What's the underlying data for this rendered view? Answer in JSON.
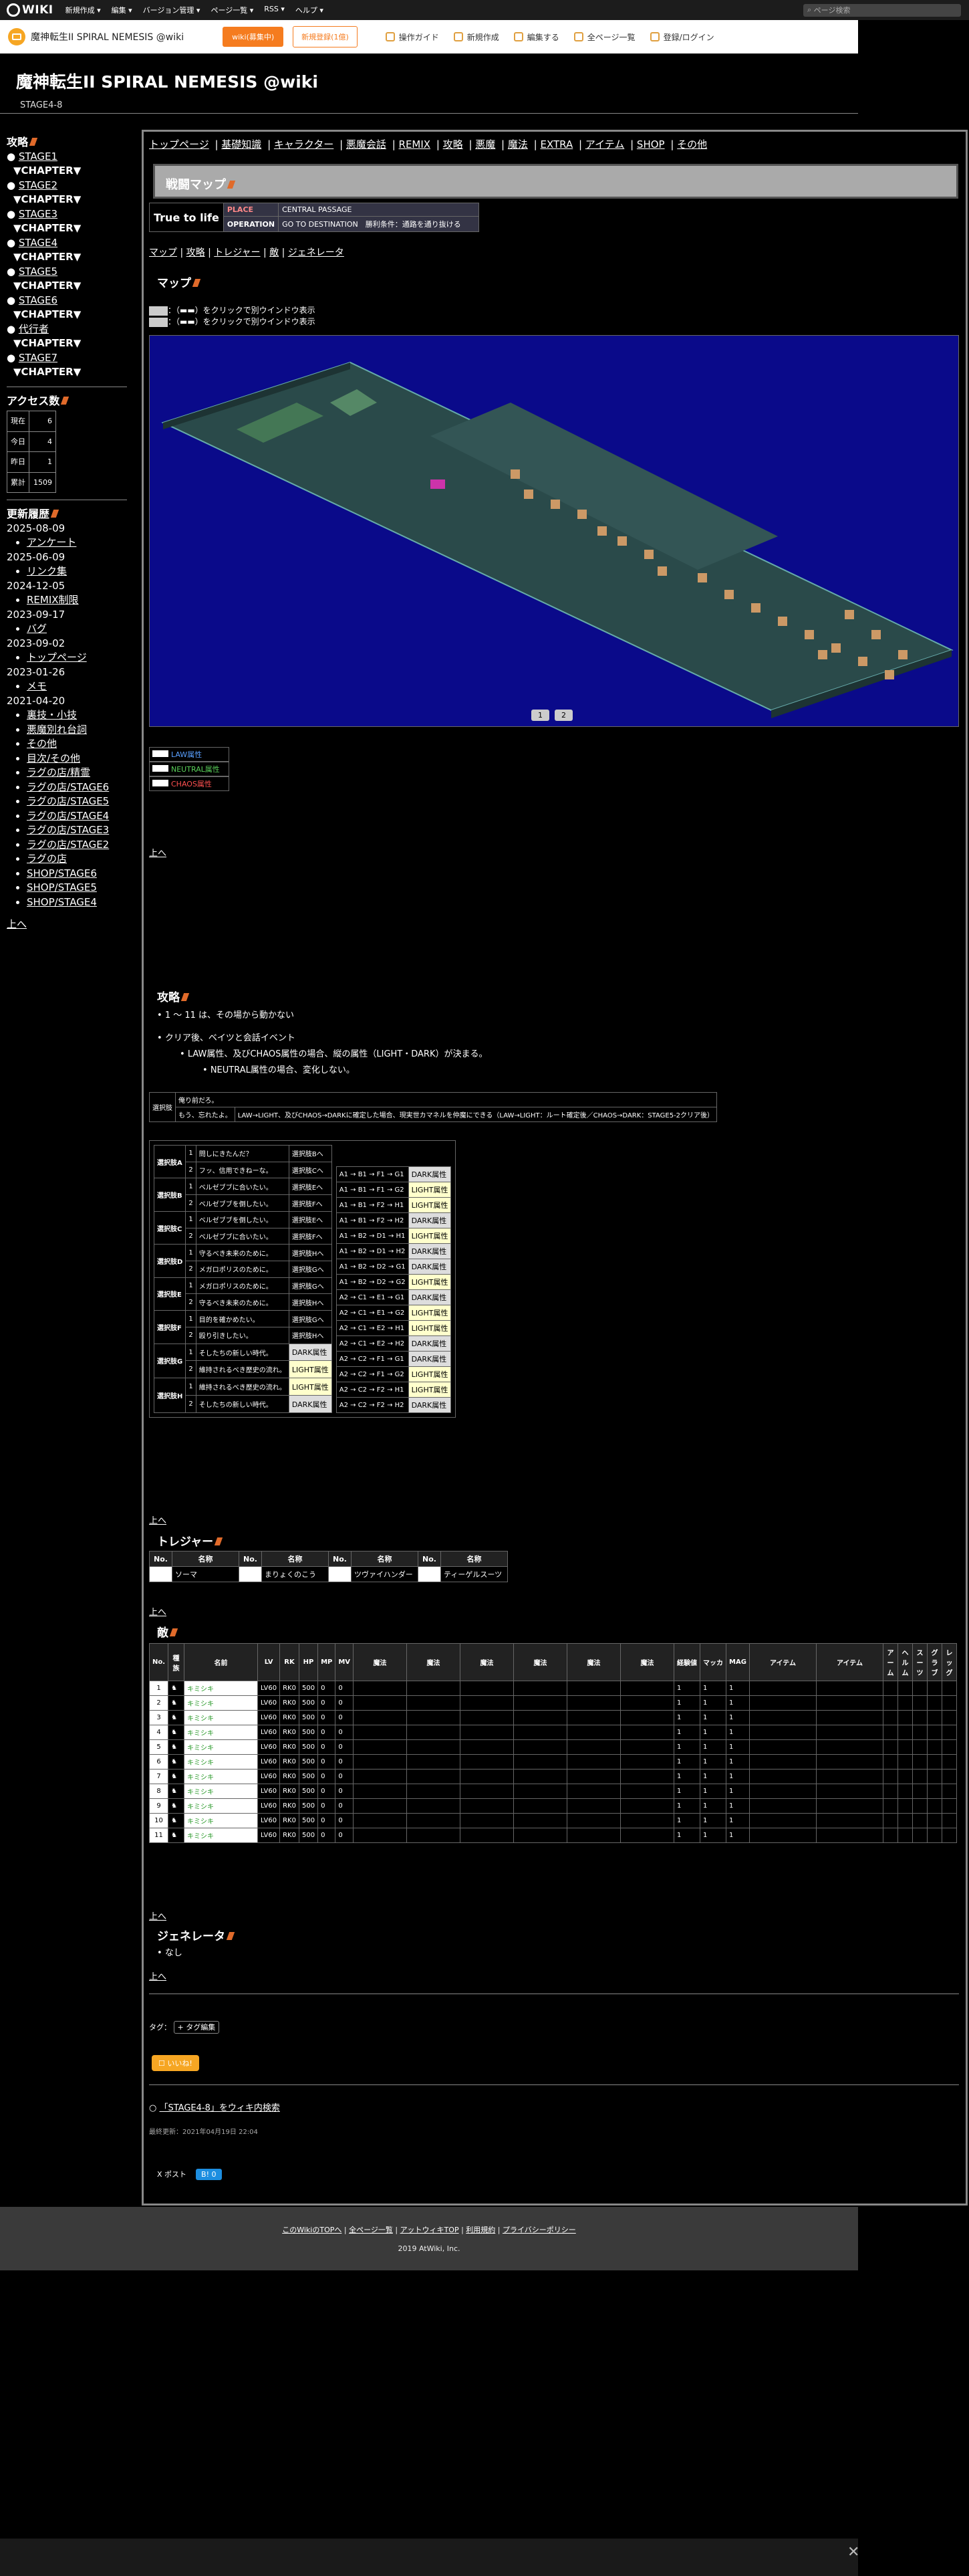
{
  "topbar": {
    "logo": "WIKI",
    "menu": [
      "新規作成 ▾",
      "編集 ▾",
      "バージョン管理 ▾",
      "ページ一覧 ▾",
      "RSS ▾",
      "ヘルプ ▾"
    ],
    "search_placeholder": "ページ検索"
  },
  "wikibar": {
    "title": "魔神転生II SPIRAL NEMESIS @wiki",
    "wiki_btn": "wiki(募集中)",
    "register_btn": "新規登録(1億)",
    "actions": [
      "操作ガイド",
      "新規作成",
      "編集する",
      "全ページ一覧",
      "登録/ログイン"
    ]
  },
  "header": {
    "title": "魔神転生II SPIRAL NEMESIS @wiki",
    "subtitle": "STAGE4-8"
  },
  "sidebar": {
    "strategy_title": "攻略",
    "stages": [
      {
        "stage": "STAGE1",
        "chapter": "▼CHAPTER▼"
      },
      {
        "stage": "STAGE2",
        "chapter": "▼CHAPTER▼"
      },
      {
        "stage": "STAGE3",
        "chapter": "▼CHAPTER▼"
      },
      {
        "stage": "STAGE4",
        "chapter": "▼CHAPTER▼"
      },
      {
        "stage": "STAGE5",
        "chapter": "▼CHAPTER▼"
      },
      {
        "stage": "STAGE6",
        "chapter": "▼CHAPTER▼"
      },
      {
        "stage": "代行者",
        "chapter": "▼CHAPTER▼"
      },
      {
        "stage": "STAGE7",
        "chapter": "▼CHAPTER▼"
      }
    ],
    "access_title": "アクセス数",
    "access": [
      [
        "現在",
        "6"
      ],
      [
        "今日",
        "4"
      ],
      [
        "昨日",
        "1"
      ],
      [
        "累計",
        "1509"
      ]
    ],
    "history_title": "更新履歴",
    "history": [
      {
        "date": "2025-08-09",
        "items": [
          "アンケート"
        ]
      },
      {
        "date": "2025-06-09",
        "items": [
          "リンク集"
        ]
      },
      {
        "date": "2024-12-05",
        "items": [
          "REMIX制限"
        ]
      },
      {
        "date": "2023-09-17",
        "items": [
          "バグ"
        ]
      },
      {
        "date": "2023-09-02",
        "items": [
          "トップページ"
        ]
      },
      {
        "date": "2023-01-26",
        "items": [
          "メモ"
        ]
      },
      {
        "date": "2021-04-20",
        "items": [
          "裏技・小技",
          "悪魔別れ台詞",
          "その他",
          "目次/その他",
          "ラグの店/精霊",
          "ラグの店/STAGE6",
          "ラグの店/STAGE5",
          "ラグの店/STAGE4",
          "ラグの店/STAGE3",
          "ラグの店/STAGE2",
          "ラグの店",
          "SHOP/STAGE6",
          "SHOP/STAGE5",
          "SHOP/STAGE4"
        ]
      }
    ],
    "top_link": "上へ"
  },
  "main": {
    "nav": [
      "トップページ",
      "基礎知識",
      "キャラクター",
      "悪魔会話",
      "REMIX",
      "攻略",
      "悪魔",
      "魔法",
      "EXTRA",
      "アイテム",
      "SHOP",
      "その他"
    ],
    "page_title": "戦闘マップ",
    "info_name": "True to life",
    "info": [
      [
        "PLACE",
        "CENTRAL PASSAGE"
      ],
      [
        "OPERATION",
        "GO TO DESTINATION　勝利条件：通路を通り抜ける"
      ]
    ],
    "subnav": [
      "マップ",
      "攻略",
      "トレジャー",
      "敵",
      "ジェネレータ"
    ],
    "map_title": "マップ",
    "map_notes": [
      "：（▬▬）をクリックで別ウインドウ表示",
      "：（▬▬）をクリックで別ウインドウ表示"
    ],
    "map_pages": [
      "1",
      "2"
    ],
    "legend": [
      [
        "LAW属性",
        "#5aa0ff"
      ],
      [
        "NEUTRAL属性",
        "#5ad05a"
      ],
      [
        "CHAOS属性",
        "#ff5050"
      ]
    ],
    "up": "上へ",
    "strategy_title": "攻略",
    "strategy_items": [
      "1 ～ 11 は、その場から動かない",
      "クリア後、ベイツと会話イベント"
    ],
    "strategy_sub": [
      "LAW属性、及びCHAOS属性の場合、縦の属性（LIGHT・DARK）が決まる。"
    ],
    "strategy_sub2": [
      "NEUTRAL属性の場合、変化しない。"
    ],
    "choice_label": "選択肢",
    "choice_rows": [
      "俺り前だろ。",
      "もう、忘れたよ。"
    ],
    "choice_note": "LAW→LIGHT、及びCHAOS→DARKに確定した場合、現実世カマネルを仲魔にできる（LAW→LIGHT：ルート確定後／CHAOS→DARK：STAGE5-2クリア後）",
    "branch_groups": [
      {
        "label": "選択肢A",
        "rows": [
          [
            "1",
            "問しにきたんだ？",
            "選択肢Bへ"
          ],
          [
            "2",
            "フッ、信用できねーな。",
            "選択肢Cへ"
          ]
        ]
      },
      {
        "label": "選択肢B",
        "rows": [
          [
            "1",
            "ベルゼブブに合いたい。",
            "選択肢Eへ"
          ],
          [
            "2",
            "ベルゼブブを倒したい。",
            "選択肢Fへ"
          ]
        ]
      },
      {
        "label": "選択肢C",
        "rows": [
          [
            "1",
            "ベルゼブブを倒したい。",
            "選択肢Eへ"
          ],
          [
            "2",
            "ベルゼブブに合いたい。",
            "選択肢Fへ"
          ]
        ]
      },
      {
        "label": "選択肢D",
        "rows": [
          [
            "1",
            "守るべき未来のために。",
            "選択肢Hへ"
          ],
          [
            "2",
            "メガロポリスのために。",
            "選択肢Gへ"
          ]
        ]
      },
      {
        "label": "選択肢E",
        "rows": [
          [
            "1",
            "メガロポリスのために。",
            "選択肢Gへ"
          ],
          [
            "2",
            "守るべき未来のために。",
            "選択肢Hへ"
          ]
        ]
      },
      {
        "label": "選択肢F",
        "rows": [
          [
            "1",
            "目的を確かめたい。",
            "選択肢Gへ"
          ],
          [
            "2",
            "殴り引きしたい。",
            "選択肢Hへ"
          ]
        ]
      },
      {
        "label": "選択肢G",
        "rows": [
          [
            "1",
            "そしたちの新しい時代。",
            "DARK属性"
          ],
          [
            "2",
            "維持されるべき歴史の流れ。",
            "LIGHT属性"
          ]
        ]
      },
      {
        "label": "選択肢H",
        "rows": [
          [
            "1",
            "維持されるべき歴史の流れ。",
            "LIGHT属性"
          ],
          [
            "2",
            "そしたちの新しい時代。",
            "DARK属性"
          ]
        ]
      }
    ],
    "routes": [
      [
        "A1 → B1 → F1 → G1",
        "DARK属性"
      ],
      [
        "A1 → B1 → F1 → G2",
        "LIGHT属性"
      ],
      [
        "A1 → B1 → F2 → H1",
        "LIGHT属性"
      ],
      [
        "A1 → B1 → F2 → H2",
        "DARK属性"
      ],
      [
        "A1 → B2 → D1 → H1",
        "LIGHT属性"
      ],
      [
        "A1 → B2 → D1 → H2",
        "DARK属性"
      ],
      [
        "A1 → B2 → D2 → G1",
        "DARK属性"
      ],
      [
        "A1 → B2 → D2 → G2",
        "LIGHT属性"
      ],
      [
        "A2 → C1 → E1 → G1",
        "DARK属性"
      ],
      [
        "A2 → C1 → E1 → G2",
        "LIGHT属性"
      ],
      [
        "A2 → C1 → E2 → H1",
        "LIGHT属性"
      ],
      [
        "A2 → C1 → E2 → H2",
        "DARK属性"
      ],
      [
        "A2 → C2 → F1 → G1",
        "DARK属性"
      ],
      [
        "A2 → C2 → F1 → G2",
        "LIGHT属性"
      ],
      [
        "A2 → C2 → F2 → H1",
        "LIGHT属性"
      ],
      [
        "A2 → C2 → F2 → H2",
        "DARK属性"
      ]
    ],
    "treasure_title": "トレジャー",
    "treasure_headers": [
      "No.",
      "名称",
      "No.",
      "名称",
      "No.",
      "名称",
      "No.",
      "名称"
    ],
    "treasure_row": [
      "",
      "ソーマ",
      "",
      "まりょくのこう",
      "",
      "ツヴァイハンダー",
      "",
      "ティーゲルスーツ"
    ],
    "enemy_title": "敵",
    "enemy_headers": [
      "No.",
      "種族",
      "名前",
      "LV",
      "RK",
      "HP",
      "MP",
      "MV",
      "魔法",
      "魔法",
      "魔法",
      "魔法",
      "魔法",
      "魔法",
      "経験値",
      "マッカ",
      "MAG",
      "アイテム",
      "アイテム",
      "アーム",
      "ヘルム",
      "スーツ",
      "グラブ",
      "レッグ"
    ],
    "enemy_rows": [
      [
        "1",
        "キミシキ",
        "LV60",
        "RK0",
        "500",
        "0",
        "0"
      ],
      [
        "2",
        "キミシキ",
        "LV60",
        "RK0",
        "500",
        "0",
        "0"
      ],
      [
        "3",
        "キミシキ",
        "LV60",
        "RK0",
        "500",
        "0",
        "0"
      ],
      [
        "4",
        "キミシキ",
        "LV60",
        "RK0",
        "500",
        "0",
        "0"
      ],
      [
        "5",
        "キミシキ",
        "LV60",
        "RK0",
        "500",
        "0",
        "0"
      ],
      [
        "6",
        "キミシキ",
        "LV60",
        "RK0",
        "500",
        "0",
        "0"
      ],
      [
        "7",
        "キミシキ",
        "LV60",
        "RK0",
        "500",
        "0",
        "0"
      ],
      [
        "8",
        "キミシキ",
        "LV60",
        "RK0",
        "500",
        "0",
        "0"
      ],
      [
        "9",
        "キミシキ",
        "LV60",
        "RK0",
        "500",
        "0",
        "0"
      ],
      [
        "10",
        "キミシキ",
        "LV60",
        "RK0",
        "500",
        "0",
        "0"
      ],
      [
        "11",
        "キミシキ",
        "LV60",
        "RK0",
        "500",
        "0",
        "0"
      ]
    ],
    "enemy_exp": [
      "1",
      "1",
      "1"
    ],
    "generator_title": "ジェネレータ",
    "generator_items": [
      "なし"
    ],
    "tag_label": "タグ：",
    "tag_btn": "+ タグ編集",
    "like_btn": "いいね!",
    "search_link": "「STAGE4-8」をウィキ内検索",
    "last_update": "最終更新：2021年04月19日 22:04",
    "share_x": "X ポスト",
    "share_b": "B! 0"
  },
  "footer": {
    "links": [
      "このWikiのTOPへ",
      "全ページ一覧",
      "アットウィキTOP",
      "利用規約",
      "プライバシーポリシー"
    ],
    "copy": "2019 AtWiki, Inc."
  }
}
